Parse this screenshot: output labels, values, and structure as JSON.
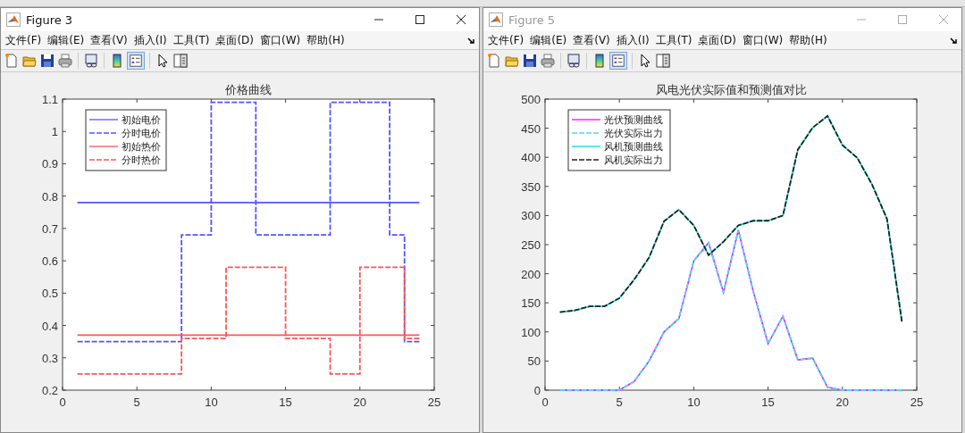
{
  "windows": [
    {
      "title": "Figure 3",
      "active": true,
      "menu": [
        "文件(F)",
        "编辑(E)",
        "查看(V)",
        "插入(I)",
        "工具(T)",
        "桌面(D)",
        "窗口(W)",
        "帮助(H)"
      ],
      "legend_button_on": true,
      "chart_data": {
        "type": "line",
        "title": "价格曲线",
        "legend": "upper left",
        "xlim": [
          0,
          25
        ],
        "ylim": [
          0.2,
          1.1
        ],
        "xticks": [
          0,
          5,
          10,
          15,
          20,
          25
        ],
        "yticks": [
          0.2,
          0.3,
          0.4,
          0.5,
          0.6,
          0.7,
          0.8,
          0.9,
          {
            "value": 1,
            "label": "1"
          },
          1.1
        ],
        "series": [
          {
            "name": "初始电价",
            "color": "#5555ff",
            "line_style": "solid",
            "x": [
              1,
              24
            ],
            "values": [
              0.78,
              0.78
            ]
          },
          {
            "name": "分时电价",
            "color": "#5555ff",
            "line_style": "dashed",
            "x": [
              1,
              8,
              8,
              10,
              10,
              13,
              13,
              18,
              18,
              22,
              22,
              23,
              23,
              24
            ],
            "values": [
              0.35,
              0.35,
              0.68,
              0.68,
              1.09,
              1.09,
              0.68,
              0.68,
              1.09,
              1.09,
              0.68,
              0.68,
              0.35,
              0.35
            ]
          },
          {
            "name": "初始热价",
            "color": "#ff5555",
            "line_style": "solid",
            "x": [
              1,
              24
            ],
            "values": [
              0.37,
              0.37
            ]
          },
          {
            "name": "分时热价",
            "color": "#ff5555",
            "line_style": "dashed",
            "x": [
              1,
              8,
              8,
              11,
              11,
              15,
              15,
              18,
              18,
              20,
              20,
              23,
              23,
              24
            ],
            "values": [
              0.25,
              0.25,
              0.36,
              0.36,
              0.58,
              0.58,
              0.36,
              0.36,
              0.25,
              0.25,
              0.58,
              0.58,
              0.36,
              0.36
            ]
          }
        ]
      }
    },
    {
      "title": "Figure 5",
      "active": false,
      "menu": [
        "文件(F)",
        "编辑(E)",
        "查看(V)",
        "插入(I)",
        "工具(T)",
        "桌面(D)",
        "窗口(W)",
        "帮助(H)"
      ],
      "legend_button_on": true,
      "chart_data": {
        "type": "line",
        "title": "风电光伏实际值和预测值对比",
        "legend": "upper left",
        "xlim": [
          0,
          25
        ],
        "ylim": [
          0,
          500
        ],
        "xticks": [
          0,
          5,
          10,
          15,
          20,
          25
        ],
        "yticks": [
          0,
          50,
          100,
          150,
          200,
          250,
          300,
          350,
          400,
          450,
          500
        ],
        "series": [
          {
            "name": "光伏预测曲线",
            "color": "#ff00ff",
            "line_style": "solid",
            "x": [
              1,
              2,
              3,
              4,
              5,
              6,
              7,
              8,
              9,
              10,
              11,
              12,
              13,
              14,
              15,
              16,
              17,
              18,
              19,
              20,
              21,
              22,
              23,
              24
            ],
            "values": [
              0,
              0,
              0,
              0,
              0,
              15,
              50,
              100,
              123,
              222,
              253,
              168,
              275,
              170,
              80,
              127,
              52,
              55,
              5,
              0,
              0,
              0,
              0,
              0
            ]
          },
          {
            "name": "光伏实际出力",
            "color": "#4dd8ee",
            "line_style": "dashed",
            "x": [
              1,
              2,
              3,
              4,
              5,
              6,
              7,
              8,
              9,
              10,
              11,
              12,
              13,
              14,
              15,
              16,
              17,
              18,
              19,
              20,
              21,
              22,
              23,
              24
            ],
            "values": [
              0,
              0,
              0,
              0,
              0,
              15,
              50,
              100,
              123,
              222,
              253,
              168,
              275,
              170,
              80,
              127,
              52,
              55,
              5,
              0,
              0,
              0,
              0,
              0
            ]
          },
          {
            "name": "风机预测曲线",
            "color": "#00e0e0",
            "line_style": "solid",
            "x": [
              1,
              2,
              3,
              4,
              5,
              6,
              7,
              8,
              9,
              10,
              11,
              12,
              13,
              14,
              15,
              16,
              17,
              18,
              19,
              20,
              21,
              22,
              23,
              24
            ],
            "values": [
              134,
              137,
              144,
              144,
              158,
              190,
              228,
              290,
              310,
              283,
              232,
              255,
              283,
              291,
              291,
              300,
              413,
              451,
              471,
              421,
              399,
              353,
              294,
              118
            ]
          },
          {
            "name": "风机实际出力",
            "color": "#222222",
            "line_style": "dashed",
            "x": [
              1,
              2,
              3,
              4,
              5,
              6,
              7,
              8,
              9,
              10,
              11,
              12,
              13,
              14,
              15,
              16,
              17,
              18,
              19,
              20,
              21,
              22,
              23,
              24
            ],
            "values": [
              134,
              137,
              144,
              144,
              158,
              190,
              228,
              290,
              310,
              283,
              232,
              255,
              283,
              291,
              291,
              300,
              413,
              451,
              471,
              421,
              399,
              353,
              294,
              118
            ]
          }
        ]
      }
    }
  ]
}
